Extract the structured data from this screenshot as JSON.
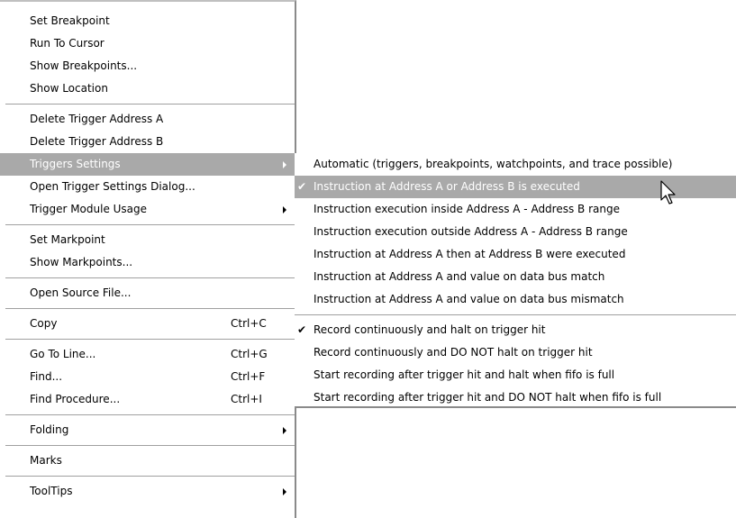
{
  "main_menu": {
    "group1": [
      {
        "label": "Set Breakpoint"
      },
      {
        "label": "Run To Cursor"
      },
      {
        "label": "Show Breakpoints..."
      },
      {
        "label": "Show Location"
      }
    ],
    "group2": [
      {
        "label": "Delete Trigger Address A"
      },
      {
        "label": "Delete Trigger Address B"
      },
      {
        "label": "Triggers Settings"
      },
      {
        "label": "Open Trigger Settings Dialog..."
      },
      {
        "label": "Trigger Module Usage"
      }
    ],
    "group3": [
      {
        "label": "Set Markpoint"
      },
      {
        "label": "Show Markpoints..."
      }
    ],
    "group4": [
      {
        "label": "Open Source File..."
      }
    ],
    "group5": [
      {
        "label": "Copy",
        "shortcut": "Ctrl+C"
      }
    ],
    "group6": [
      {
        "label": "Go To Line...",
        "shortcut": "Ctrl+G"
      },
      {
        "label": "Find...",
        "shortcut": "Ctrl+F"
      },
      {
        "label": "Find Procedure...",
        "shortcut": "Ctrl+I"
      }
    ],
    "group7": [
      {
        "label": "Folding"
      }
    ],
    "group8": [
      {
        "label": "Marks"
      }
    ],
    "group9": [
      {
        "label": "ToolTips"
      }
    ]
  },
  "sub_menu": {
    "trigger_modes": [
      {
        "label": "Automatic (triggers, breakpoints, watchpoints, and trace possible)"
      },
      {
        "label": "Instruction at Address A or Address B is executed",
        "checked": true
      },
      {
        "label": "Instruction execution inside Address A - Address B range"
      },
      {
        "label": "Instruction execution outside Address A - Address B range"
      },
      {
        "label": "Instruction at Address A then at Address B were executed"
      },
      {
        "label": "Instruction at Address A and value on data bus match"
      },
      {
        "label": "Instruction at Address A and value on data bus mismatch"
      }
    ],
    "record_modes": [
      {
        "label": "Record continuously and halt on trigger hit",
        "checked": true
      },
      {
        "label": "Record continuously and DO NOT halt on trigger hit"
      },
      {
        "label": "Start recording after trigger hit and halt when fifo is full"
      },
      {
        "label": "Start recording after trigger hit and DO NOT halt when fifo is full"
      }
    ]
  },
  "check_mark": "✔",
  "colors": {
    "highlight": "#a9a9a9",
    "highlight_text": "#ffffff"
  }
}
